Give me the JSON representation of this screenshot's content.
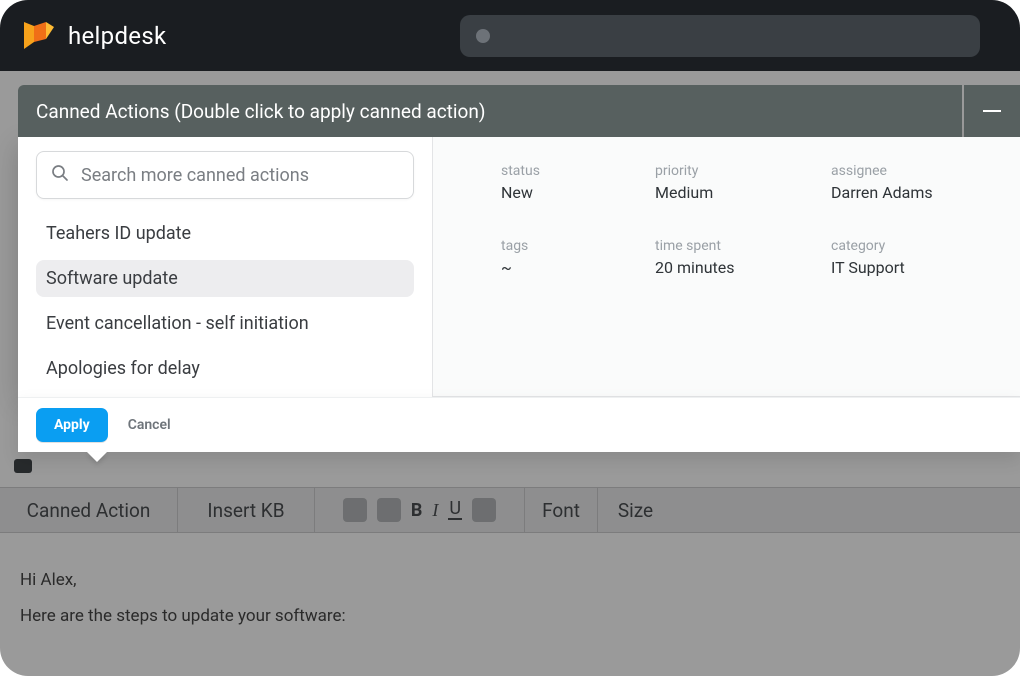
{
  "brand": "helpdesk",
  "flyout": {
    "title": "Canned Actions (Double click to apply canned action)",
    "search_placeholder": "Search more canned actions",
    "actions": [
      {
        "label": "Teahers ID update",
        "selected": false
      },
      {
        "label": "Software update",
        "selected": true
      },
      {
        "label": "Event cancellation - self initiation",
        "selected": false
      },
      {
        "label": "Apologies for delay",
        "selected": false
      }
    ],
    "apply_label": "Apply",
    "cancel_label": "Cancel"
  },
  "ticket_meta": {
    "status": {
      "label": "status",
      "value": "New"
    },
    "priority": {
      "label": "priority",
      "value": "Medium"
    },
    "assignee": {
      "label": "assignee",
      "value": "Darren Adams"
    },
    "tags": {
      "label": "tags",
      "value": "~"
    },
    "time_spent": {
      "label": "time spent",
      "value": "20 minutes"
    },
    "category": {
      "label": "category",
      "value": "IT Support"
    }
  },
  "toolbar": {
    "canned_action": "Canned Action",
    "insert_kb": "Insert KB",
    "font": "Font",
    "size": "Size",
    "bold_glyph": "B",
    "italic_glyph": "I",
    "underline_glyph": "U"
  },
  "editor": {
    "line1": "Hi Alex,",
    "line2": "Here are the steps to update your software:"
  }
}
